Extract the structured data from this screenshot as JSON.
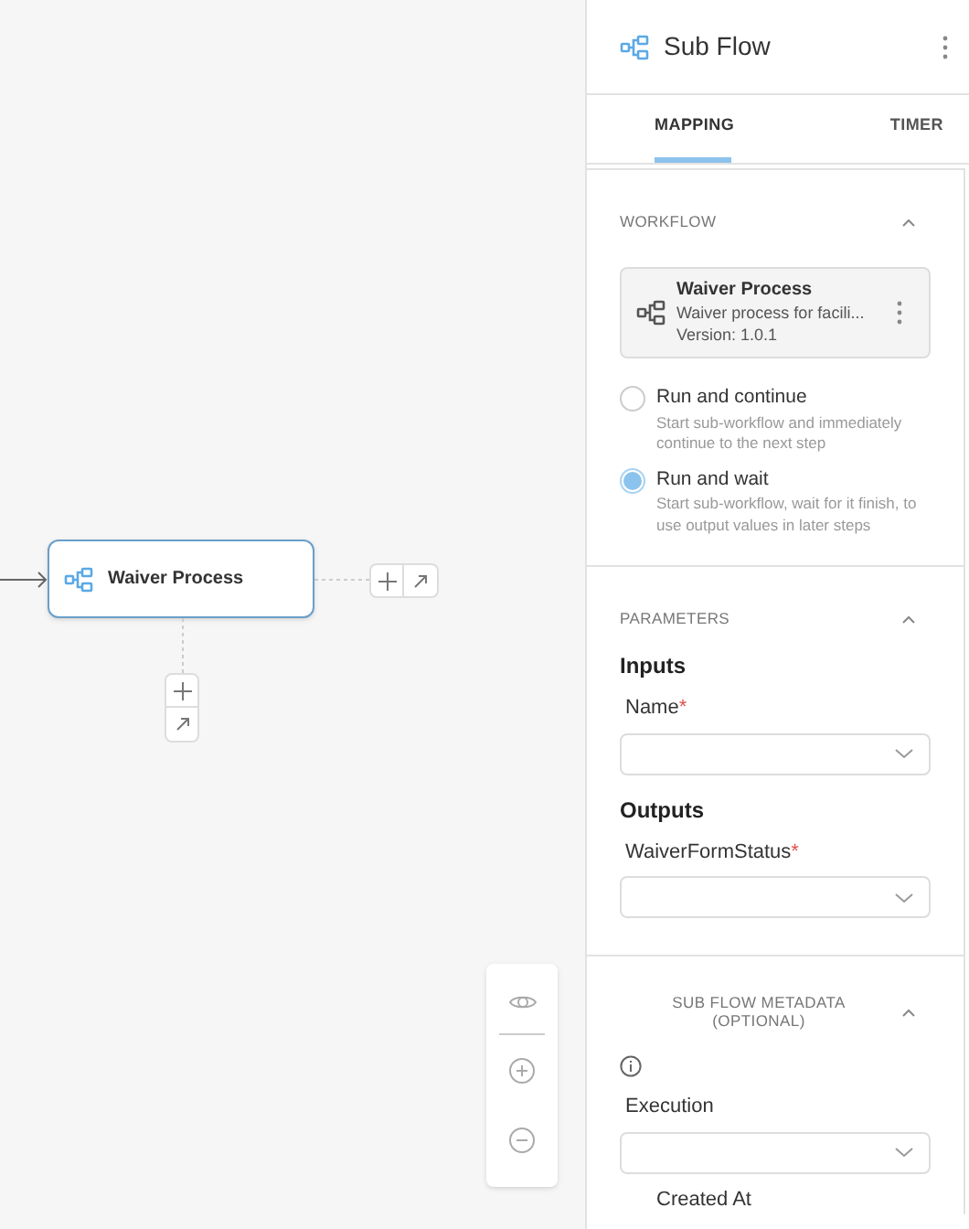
{
  "canvas": {
    "node": {
      "title": "Waiver Process",
      "selected": true
    }
  },
  "panel": {
    "title": "Sub Flow",
    "tabs": [
      {
        "label": "MAPPING",
        "selected": true
      },
      {
        "label": "TIMER",
        "selected": false
      }
    ],
    "workflow": {
      "heading": "WORKFLOW",
      "expanded": true,
      "card": {
        "name": "Waiver Process",
        "description": "Waiver process for facili...",
        "version": "Version: 1.0.1"
      },
      "options": [
        {
          "label": "Run and continue",
          "description": "Start sub-workflow and immediately continue to the next step",
          "selected": false
        },
        {
          "label": "Run and wait",
          "description": "Start sub-workflow, wait for it finish, to use output values in later steps",
          "selected": true
        }
      ]
    },
    "parameters": {
      "heading": "PARAMETERS",
      "expanded": true,
      "groups": [
        {
          "title": "Inputs",
          "fields": [
            {
              "label": "Name",
              "required_mark": "*"
            }
          ]
        },
        {
          "title": "Outputs",
          "fields": [
            {
              "label": "WaiverFormStatus",
              "required_mark": "*"
            }
          ]
        }
      ]
    },
    "metadata": {
      "heading": "SUB FLOW METADATA (OPTIONAL)",
      "expanded": true,
      "fields": [
        {
          "label": "Execution"
        }
      ],
      "next_label": "Created At"
    }
  }
}
